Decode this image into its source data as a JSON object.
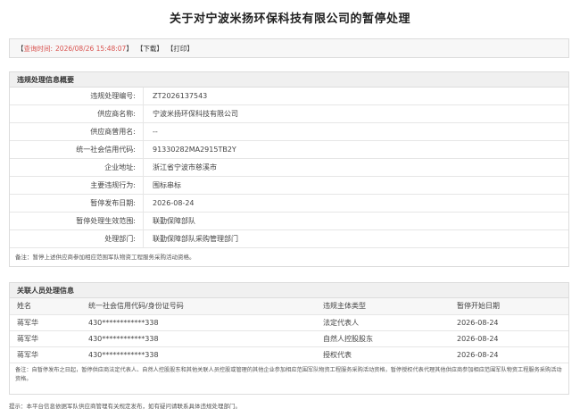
{
  "title": "关于对宁波米扬环保科技有限公司的暂停处理",
  "query_bar": {
    "query_label": "查询时间:",
    "query_time": "2026/08/26 15:48:07",
    "download": "下载",
    "print": "打印"
  },
  "violation": {
    "header": "违规处理信息概要",
    "rows": [
      {
        "label": "违规处理编号:",
        "value": "ZT2026137543"
      },
      {
        "label": "供应商名称:",
        "value": "宁波米扬环保科技有限公司"
      },
      {
        "label": "供应商曾用名:",
        "value": "--"
      },
      {
        "label": "统一社会信用代码:",
        "value": "91330282MA2915TB2Y"
      },
      {
        "label": "企业地址:",
        "value": "浙江省宁波市慈溪市"
      },
      {
        "label": "主要违规行为:",
        "value": "围标串标"
      },
      {
        "label": "暂停发布日期:",
        "value": "2026-08-24"
      },
      {
        "label": "暂停处理生效范围:",
        "value": "联勤保障部队"
      },
      {
        "label": "处理部门:",
        "value": "联勤保障部队采购管理部门"
      }
    ],
    "note": "备注：暂停上述供应商参加相应范围军队物资工程服务采购活动资格。"
  },
  "related": {
    "header": "关联人员处理信息",
    "columns": [
      "姓名",
      "统一社会信用代码/身份证号码",
      "违规主体类型",
      "暂停开始日期"
    ],
    "rows": [
      [
        "蒋军华",
        "430************338",
        "法定代表人",
        "2026-08-24"
      ],
      [
        "蒋军华",
        "430************338",
        "自然人控股股东",
        "2026-08-24"
      ],
      [
        "蒋军华",
        "430************338",
        "授权代表",
        "2026-08-24"
      ]
    ],
    "note": "备注：自暂停发布之日起，暂停供应商法定代表人、自然人控股股东和其他关联人员控股或管理的其他企业参加相应范围军队物资工程服务采购活动资格，暂停授权代表代理其他供应商参加相应范围军队物资工程服务采购活动资格。"
  },
  "footer_tip": "提示：本平台信息依据军队供应商管理有关规定发布，如有疑问请联系具体违规处理部门。"
}
